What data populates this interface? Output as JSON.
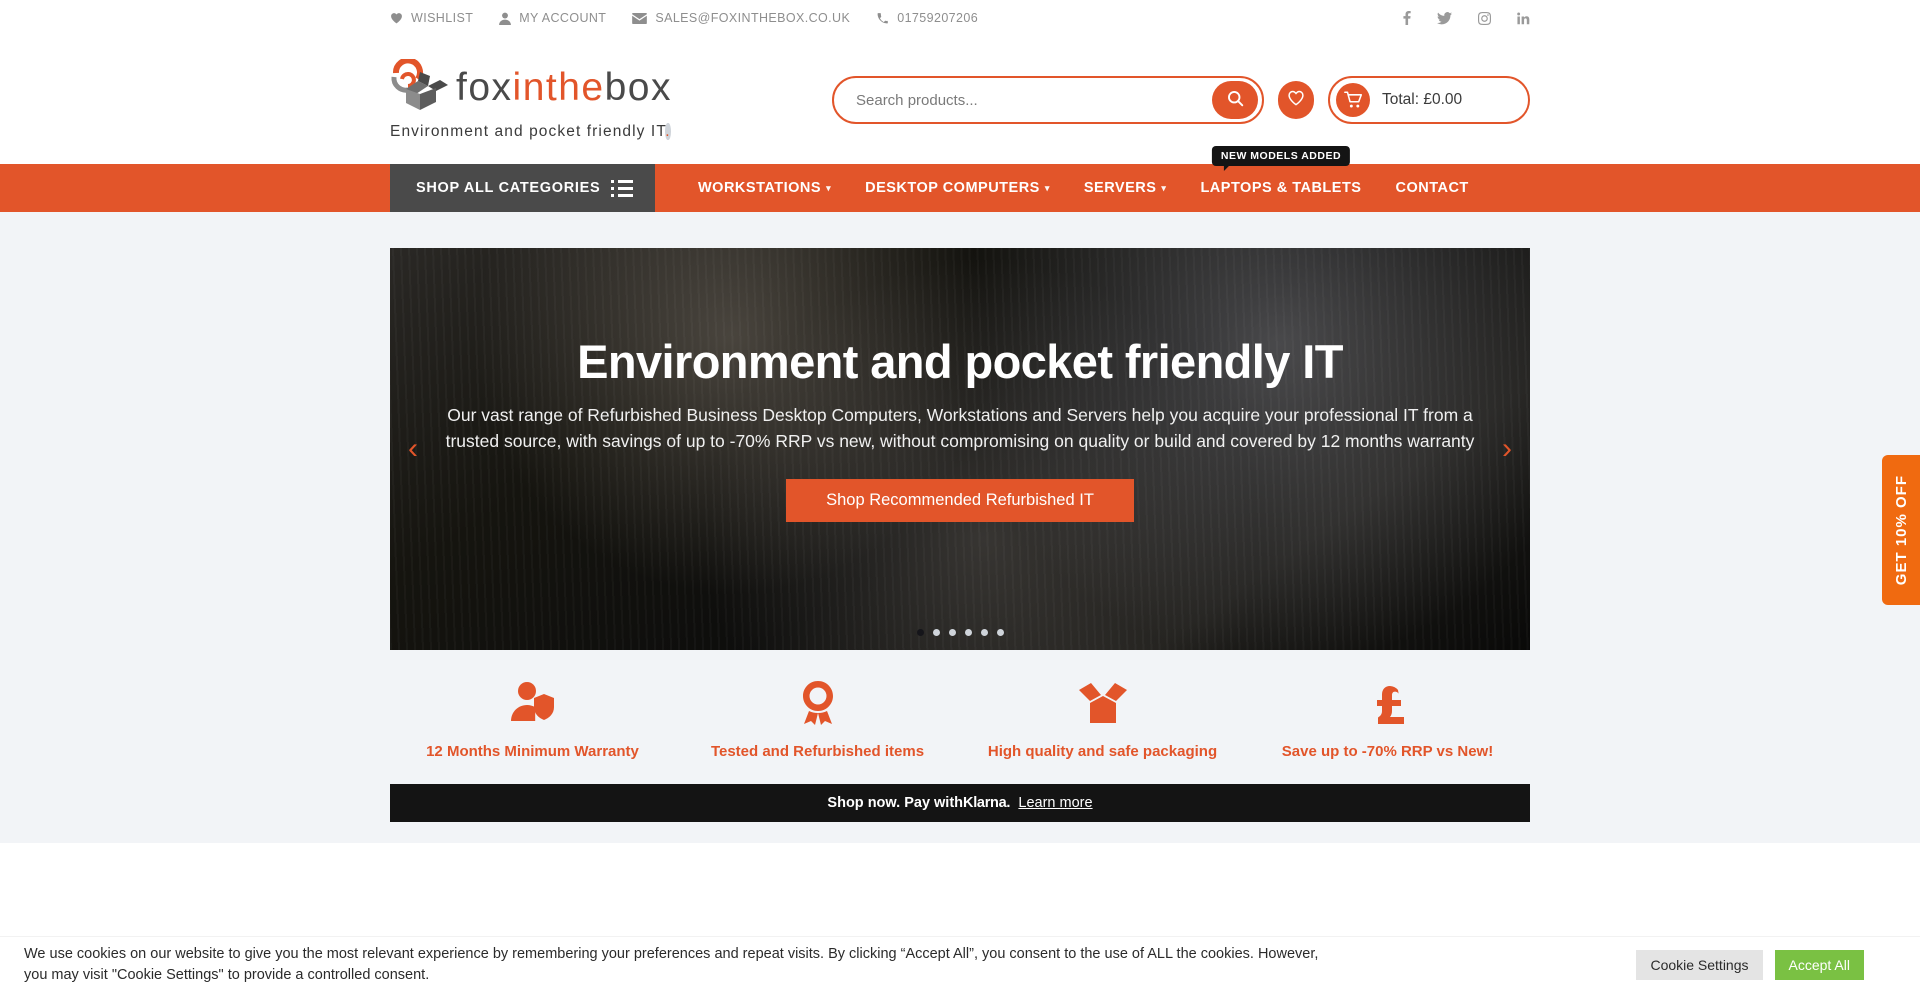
{
  "topbar": {
    "links": [
      {
        "label": "WISHLIST",
        "icon": "heart-icon"
      },
      {
        "label": "MY ACCOUNT",
        "icon": "user-icon"
      },
      {
        "label": "SALES@FOXINTHEBOX.CO.UK",
        "icon": "envelope-icon"
      },
      {
        "label": "01759207206",
        "icon": "phone-icon"
      }
    ],
    "social": [
      {
        "name": "facebook-icon",
        "glyph": "f"
      },
      {
        "name": "twitter-icon",
        "glyph": "t"
      },
      {
        "name": "instagram-icon",
        "glyph": "i"
      },
      {
        "name": "linkedin-icon",
        "glyph": "in"
      }
    ]
  },
  "header": {
    "logo": {
      "part1": "fox",
      "part2": "inthe",
      "part3": "box",
      "tagline": "Environment and pocket friendly IT",
      "tagline_dot": "."
    },
    "search": {
      "placeholder": "Search products...",
      "value": "",
      "button_icon": "search-icon"
    },
    "wishlist_icon": "heart-icon",
    "cart": {
      "icon": "cart-icon",
      "label": "Total: £0.00"
    }
  },
  "nav": {
    "shop_all": "SHOP ALL CATEGORIES",
    "menu": [
      {
        "label": "WORKSTATIONS",
        "has_caret": true,
        "badge": ""
      },
      {
        "label": "DESKTOP COMPUTERS",
        "has_caret": true,
        "badge": ""
      },
      {
        "label": "SERVERS",
        "has_caret": true,
        "badge": ""
      },
      {
        "label": "LAPTOPS & TABLETS",
        "has_caret": false,
        "badge": "NEW MODELS ADDED"
      },
      {
        "label": "CONTACT",
        "has_caret": false,
        "badge": ""
      }
    ]
  },
  "slider": {
    "title": "Environment and pocket friendly IT",
    "description": "Our vast range of Refurbished Business Desktop Computers, Workstations and Servers help you acquire your professional IT from a trusted source, with savings of up to -70% RRP vs new, without compromising on quality or build and covered by 12 months warranty",
    "cta": "Shop Recommended Refurbished IT",
    "prev_arrow": "‹",
    "next_arrow": "›",
    "dot_count": 6,
    "active_dot": 0
  },
  "features": [
    {
      "icon": "user-shield-icon",
      "label": "12 Months Minimum Warranty"
    },
    {
      "icon": "award-ribbon-icon",
      "label": "Tested and Refurbished items"
    },
    {
      "icon": "open-box-icon",
      "label": "High quality and safe packaging"
    },
    {
      "icon": "pound-sign-icon",
      "label": "Save up to -70% RRP vs New!"
    }
  ],
  "klarna": {
    "prefix": "Shop now. Pay with ",
    "brand": "Klarna",
    "suffix": ".",
    "learn_more": "Learn more"
  },
  "side_tab": {
    "label": "GET 10% OFF"
  },
  "cookie": {
    "text": "We use cookies on our website to give you the most relevant experience by remembering your preferences and repeat visits. By clicking “Accept All”, you consent to the use of ALL the cookies. However, you may visit \"Cookie Settings\" to provide a controlled consent.",
    "settings_label": "Cookie Settings",
    "accept_label": "Accept All"
  },
  "colors": {
    "accent": "#e2552a",
    "dark": "#4a4a4a",
    "black": "#141414",
    "green": "#7ac143",
    "page_bg": "#f2f4f7"
  }
}
